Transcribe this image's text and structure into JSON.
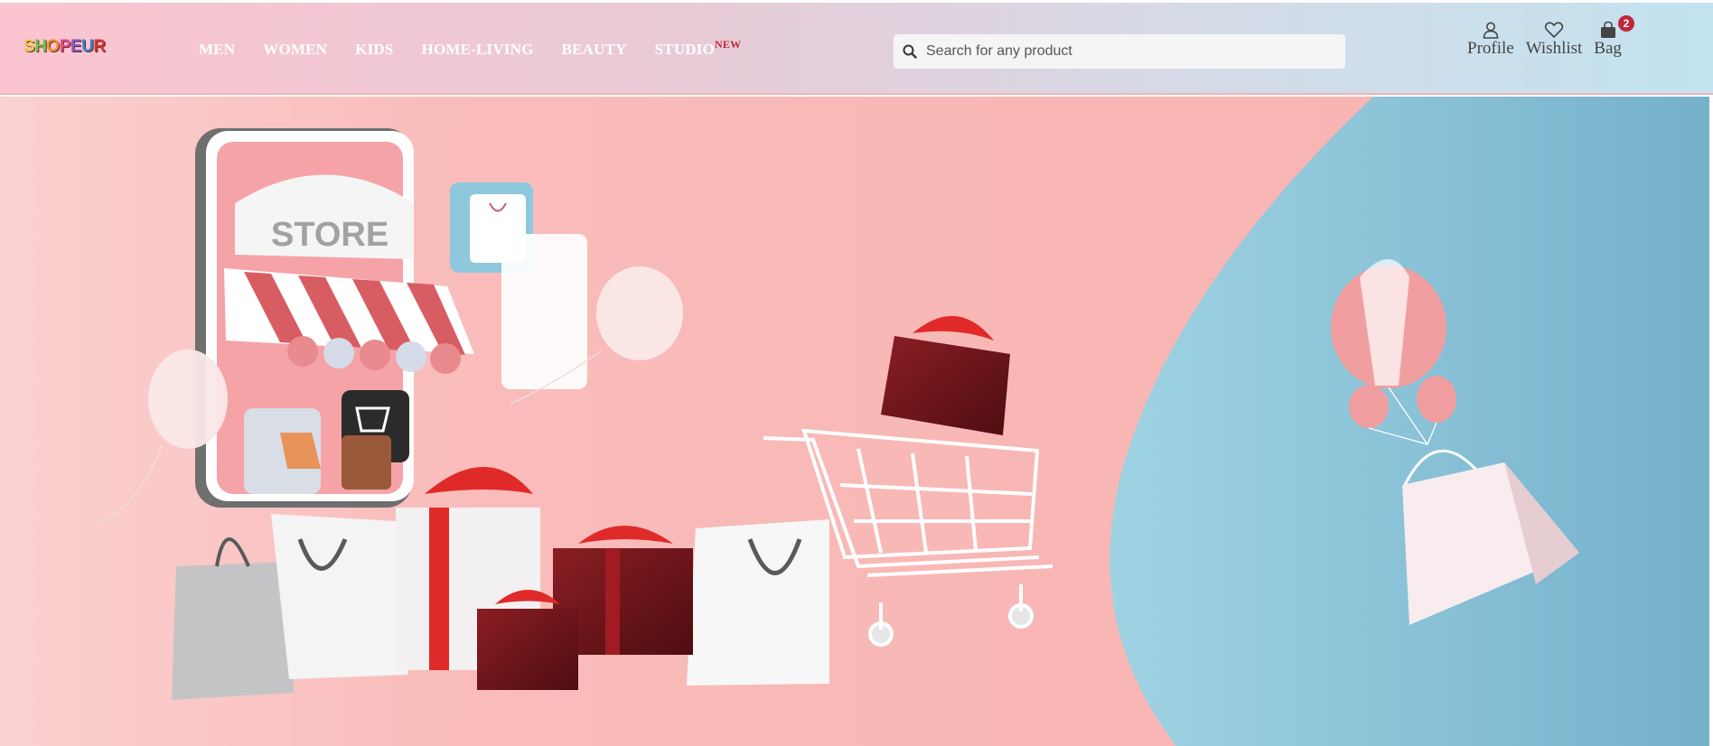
{
  "brand": {
    "logo_letters": [
      "S",
      "H",
      "O",
      "P",
      "E",
      "U",
      "R"
    ]
  },
  "nav": {
    "items": [
      {
        "label": "MEN"
      },
      {
        "label": "WOMEN"
      },
      {
        "label": "KIDS"
      },
      {
        "label": "HOME-LIVING"
      },
      {
        "label": "BEAUTY"
      },
      {
        "label": "STUDIO",
        "tag": "NEW"
      }
    ]
  },
  "search": {
    "placeholder": "Search for any product",
    "icon": "search-icon"
  },
  "actions": {
    "profile": {
      "label": "Profile",
      "icon": "user-icon"
    },
    "wishlist": {
      "label": "Wishlist",
      "icon": "heart-icon"
    },
    "bag": {
      "label": "Bag",
      "icon": "bag-icon",
      "count": "2"
    }
  },
  "hero": {
    "store_sign": "STORE",
    "colors": {
      "pink_bg": "#f8b7b5",
      "blue_bg": "#8ec8dc",
      "gift_red": "#7a1a1f",
      "ribbon": "#e02a2a"
    }
  }
}
